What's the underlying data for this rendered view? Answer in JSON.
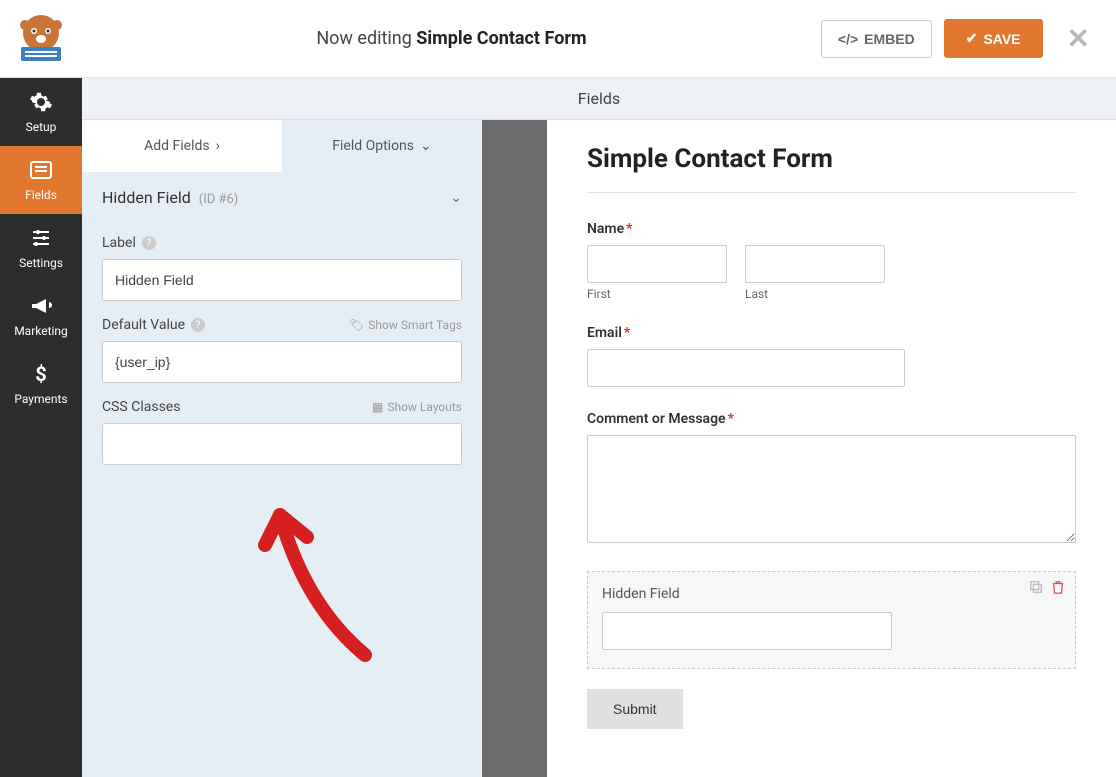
{
  "topbar": {
    "editing_prefix": "Now editing ",
    "editing_title": "Simple Contact Form",
    "embed_label": "EMBED",
    "save_label": "SAVE"
  },
  "nav": {
    "setup": "Setup",
    "fields": "Fields",
    "settings": "Settings",
    "marketing": "Marketing",
    "payments": "Payments"
  },
  "panel_header": "Fields",
  "panel_tabs": {
    "add": "Add Fields",
    "options": "Field Options"
  },
  "field_options": {
    "title": "Hidden Field",
    "id": "(ID #6)",
    "label_label": "Label",
    "label_input": "Hidden Field",
    "default_label": "Default Value",
    "smart_tags_hint": "Show Smart Tags",
    "default_input": "{user_ip}",
    "css_label": "CSS Classes",
    "layouts_hint": "Show Layouts",
    "css_input": ""
  },
  "preview": {
    "title": "Simple Contact Form",
    "name_label": "Name",
    "first_sub": "First",
    "last_sub": "Last",
    "email_label": "Email",
    "comment_label": "Comment or Message",
    "hidden_label": "Hidden Field",
    "submit_label": "Submit"
  }
}
